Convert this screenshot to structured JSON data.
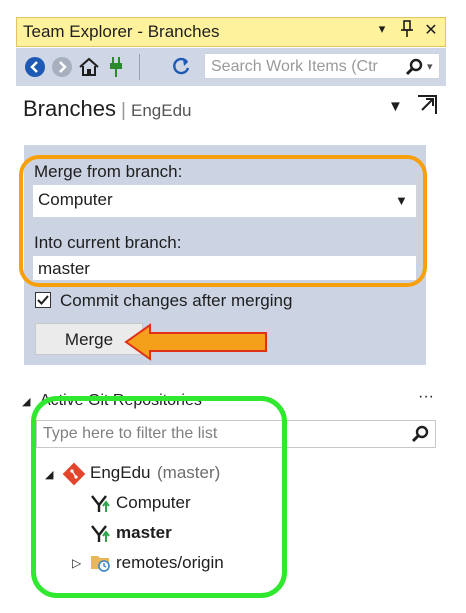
{
  "window": {
    "title": "Team Explorer - Branches",
    "controls": [
      "▾",
      "⊥",
      "✕"
    ]
  },
  "toolbar": {
    "search_placeholder": "Search Work Items (Ctr",
    "buttons": [
      "back-icon",
      "forward-icon",
      "home-icon",
      "plug-icon",
      "refresh-icon"
    ]
  },
  "header": {
    "title": "Branches",
    "separator": "|",
    "project": "EngEdu"
  },
  "merge": {
    "from_label": "Merge from branch:",
    "from_value": "Computer",
    "into_label": "Into current branch:",
    "into_value": "master",
    "commit_label": "Commit changes after merging",
    "commit_checked": true,
    "merge_button": "Merge"
  },
  "repos": {
    "section_title": "Active Git Repositories",
    "more": "···",
    "filter_placeholder": "Type here to filter the list",
    "repo_name": "EngEdu",
    "repo_branch": "(master)",
    "branches": [
      "Computer",
      "master"
    ],
    "remotes": "remotes/origin"
  },
  "colors": {
    "title_bar": "#fff29d",
    "toolbar": "#cfd6e5",
    "panel": "#ccd3e3",
    "annotation_orange": "#f7a00c",
    "annotation_green": "#2fe82f",
    "arrow": "#f5a01a"
  }
}
